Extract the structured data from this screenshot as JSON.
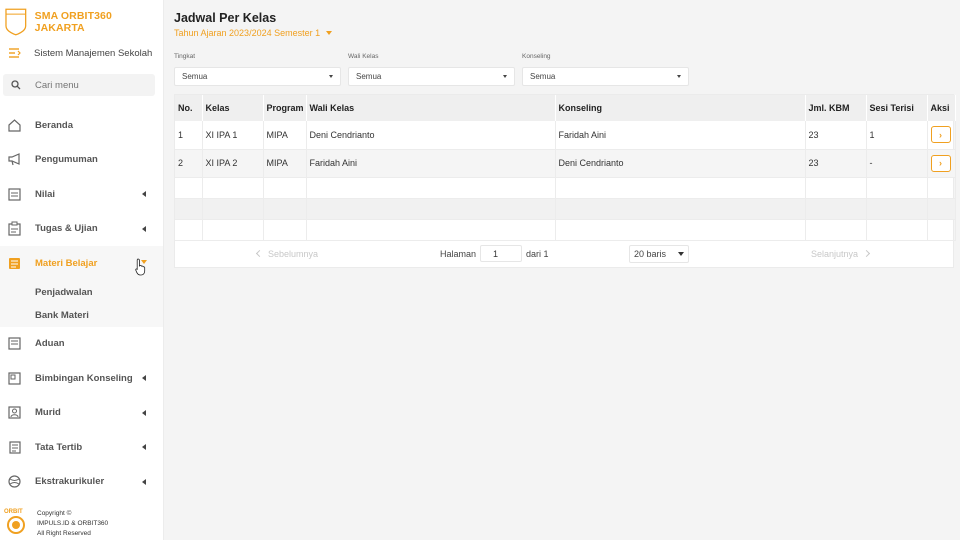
{
  "sidebar": {
    "brand": "SMA ORBIT360 JAKARTA",
    "subtitle": "Sistem Manajemen Sekolah",
    "search_placeholder": "Cari menu",
    "items": [
      {
        "label": "Beranda",
        "icon": "home-icon"
      },
      {
        "label": "Pengumuman",
        "icon": "megaphone-icon"
      },
      {
        "label": "Nilai",
        "icon": "grades-icon"
      },
      {
        "label": "Tugas & Ujian",
        "icon": "clipboard-icon"
      },
      {
        "label": "Materi Belajar",
        "icon": "book-icon",
        "active": true
      },
      {
        "label": "Aduan",
        "icon": "complaint-icon"
      },
      {
        "label": "Bimbingan Konseling",
        "icon": "counseling-icon"
      },
      {
        "label": "Murid",
        "icon": "student-icon"
      },
      {
        "label": "Tata Tertib",
        "icon": "rules-icon"
      },
      {
        "label": "Ekstrakurikuler",
        "icon": "extracurricular-icon"
      }
    ],
    "subitems": [
      "Penjadwalan",
      "Bank Materi"
    ],
    "footer": {
      "logo_text": "ORBIT",
      "line1": "Copyright ©",
      "line2": "IMPULS.ID & ORBIT360",
      "line3": "All Right Reserved"
    }
  },
  "main": {
    "title": "Jadwal Per Kelas",
    "period": "Tahun Ajaran 2023/2024 Semester 1",
    "filters": [
      {
        "label": "Tingkat",
        "value": "Semua"
      },
      {
        "label": "Wali Kelas",
        "value": "Semua"
      },
      {
        "label": "Konseling",
        "value": "Semua"
      }
    ],
    "table": {
      "headers": [
        "No.",
        "Kelas",
        "Program",
        "Wali Kelas",
        "Konseling",
        "Jml. KBM",
        "Sesi Terisi",
        "Aksi"
      ],
      "rows": [
        [
          "1",
          "XI IPA 1",
          "MIPA",
          "Deni Cendrianto",
          "Faridah Aini",
          "23",
          "1"
        ],
        [
          "2",
          "XI IPA 2",
          "MIPA",
          "Faridah Aini",
          "Deni Cendrianto",
          "23",
          "-"
        ]
      ]
    },
    "pager": {
      "prev": "Sebelumnya",
      "page_label": "Halaman",
      "page_value": "1",
      "of_label": "dari 1",
      "rows_per_page": "20 baris",
      "next": "Selanjutnya"
    }
  },
  "colors": {
    "accent": "#f0a020"
  }
}
